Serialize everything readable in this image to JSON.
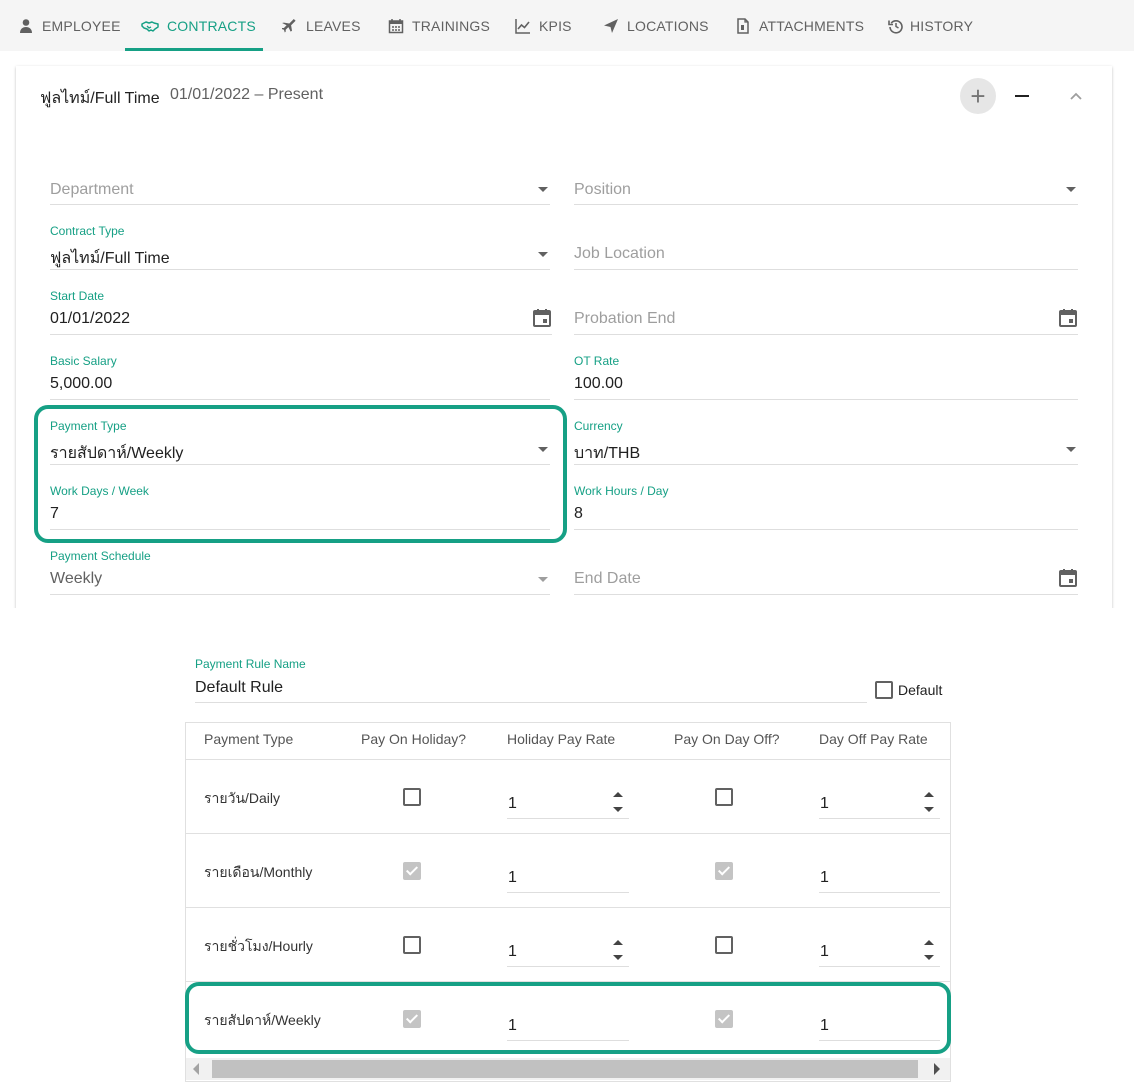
{
  "tabs": [
    {
      "label": "EMPLOYEE",
      "icon": "user-icon"
    },
    {
      "label": "CONTRACTS",
      "icon": "handshake-icon",
      "active": true
    },
    {
      "label": "LEAVES",
      "icon": "plane-icon"
    },
    {
      "label": "TRAININGS",
      "icon": "calendar-icon"
    },
    {
      "label": "KPIS",
      "icon": "chart-line-icon"
    },
    {
      "label": "LOCATIONS",
      "icon": "location-arrow-icon"
    },
    {
      "label": "ATTACHMENTS",
      "icon": "file-icon"
    },
    {
      "label": "HISTORY",
      "icon": "history-icon"
    }
  ],
  "contract": {
    "title": "ฟูลไทม์/Full Time",
    "dates": "01/01/2022 – Present"
  },
  "form": {
    "department": {
      "placeholder": "Department"
    },
    "position": {
      "placeholder": "Position"
    },
    "contract_type": {
      "label": "Contract Type",
      "value": "ฟูลไทม์/Full Time"
    },
    "job_location": {
      "placeholder": "Job Location"
    },
    "start_date": {
      "label": "Start Date",
      "value": "01/01/2022"
    },
    "probation_end": {
      "placeholder": "Probation End"
    },
    "basic_salary": {
      "label": "Basic Salary",
      "value": "5,000.00"
    },
    "ot_rate": {
      "label": "OT Rate",
      "value": "100.00"
    },
    "payment_type": {
      "label": "Payment Type",
      "value": "รายสัปดาห์/Weekly"
    },
    "currency": {
      "label": "Currency",
      "value": "บาท/THB"
    },
    "work_days": {
      "label": "Work Days / Week",
      "value": "7"
    },
    "work_hours": {
      "label": "Work Hours / Day",
      "value": "8"
    },
    "payment_schedule": {
      "label": "Payment Schedule",
      "value": "Weekly"
    },
    "end_date": {
      "placeholder": "End Date"
    }
  },
  "payment_rule": {
    "name_label": "Payment Rule Name",
    "name_value": "Default Rule",
    "default_label": "Default",
    "default_checked": false,
    "headers": [
      "Payment Type",
      "Pay On Holiday?",
      "Holiday Pay Rate",
      "Pay On Day Off?",
      "Day Off Pay Rate"
    ],
    "rows": [
      {
        "type": "รายวัน/Daily",
        "pay_on_holiday": false,
        "holiday_rate": "1",
        "pay_on_day_off": false,
        "day_off_rate": "1",
        "disabled": false
      },
      {
        "type": "รายเดือน/Monthly",
        "pay_on_holiday": true,
        "holiday_rate": "1",
        "pay_on_day_off": true,
        "day_off_rate": "1",
        "disabled": true
      },
      {
        "type": "รายชั่วโมง/Hourly",
        "pay_on_holiday": false,
        "holiday_rate": "1",
        "pay_on_day_off": false,
        "day_off_rate": "1",
        "disabled": false
      },
      {
        "type": "รายสัปดาห์/Weekly",
        "pay_on_holiday": true,
        "holiday_rate": "1",
        "pay_on_day_off": true,
        "day_off_rate": "1",
        "disabled": true
      }
    ]
  },
  "colors": {
    "accent": "#16a085",
    "highlight": "#16a085"
  }
}
